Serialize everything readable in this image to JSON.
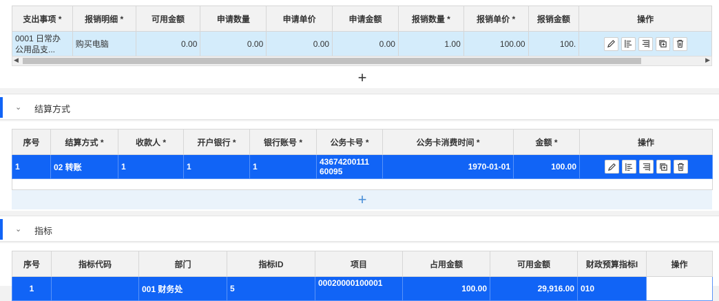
{
  "table1": {
    "columns": [
      "支出事项 *",
      "报销明细 *",
      "可用金额",
      "申请数量",
      "申请单价",
      "申请金额",
      "报销数量 *",
      "报销单价 *",
      "报销金额",
      "操作"
    ],
    "row": {
      "expense_item_line1": "0001 日常办",
      "expense_item_line2": "公用品支...",
      "detail": "购买电脑",
      "available": "0.00",
      "apply_qty": "0.00",
      "apply_price": "0.00",
      "apply_amount": "0.00",
      "claim_qty": "1.00",
      "claim_price": "100.00",
      "claim_amount": "100."
    }
  },
  "section_settlement": {
    "title": "结算方式",
    "columns": [
      "序号",
      "结算方式 *",
      "收款人 *",
      "开户银行 *",
      "银行账号 *",
      "公务卡号 *",
      "公务卡消费时间 *",
      "金额 *",
      "操作"
    ],
    "row": {
      "index": "1",
      "method": "02 转账",
      "payee": "1",
      "bank": "1",
      "account": "1",
      "card_no_line1": "43674200111",
      "card_no_line2": "60095",
      "card_time": "1970-01-01",
      "amount": "100.00"
    }
  },
  "section_indicator": {
    "title": "指标",
    "columns": [
      "序号",
      "指标代码",
      "部门",
      "指标ID",
      "项目",
      "占用金额",
      "可用金额",
      "财政预算指标I",
      "操作"
    ],
    "row_partial": {
      "index": "1",
      "dept": "001 财务处",
      "indicator_id": "5",
      "project": "00020000100001",
      "occupied": "100.00",
      "available": "29,916.00",
      "budget": "010"
    }
  },
  "icons": [
    "pencil-icon",
    "align-left-icon",
    "align-right-icon",
    "copy-icon",
    "trash-icon",
    "chevron-down-icon",
    "plus-icon",
    "scroll-left-icon",
    "scroll-right-icon"
  ],
  "colors": {
    "accent": "#1164f6",
    "selected_light": "#d4ecfb",
    "header_bg": "#f2f2f2"
  }
}
